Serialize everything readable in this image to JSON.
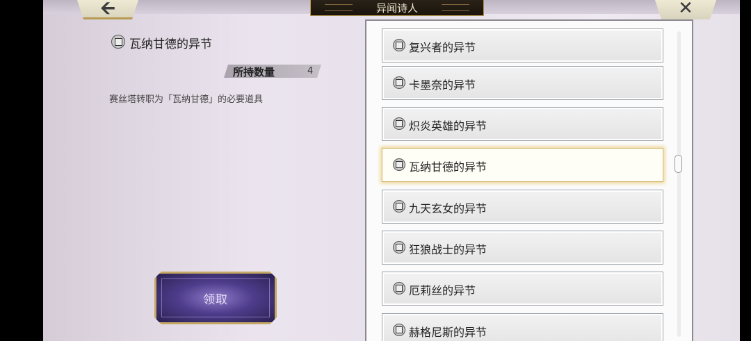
{
  "header": {
    "title": "异闻诗人",
    "back_icon": "back-arrow-icon",
    "close_icon": "close-icon"
  },
  "detail": {
    "title": "瓦纳甘德的异节",
    "quantity_label": "所持数量",
    "quantity_value": "4",
    "description": "赛丝塔转职为「瓦纳甘德」的必要道具"
  },
  "claim_button": {
    "label": "领取"
  },
  "list": {
    "items": [
      {
        "label": "复兴者的异节"
      },
      {
        "label": "卡墨奈的异节"
      },
      {
        "label": "炽炎英雄的异节"
      },
      {
        "label": "瓦纳甘德的异节",
        "selected": true
      },
      {
        "label": "九天玄女的异节"
      },
      {
        "label": "狂狼战士的异节"
      },
      {
        "label": "厄莉丝的异节"
      },
      {
        "label": "赫格尼斯的异节"
      }
    ]
  },
  "colors": {
    "selected_border": "#d3b868",
    "title_bar_bg": "#1a140c",
    "claim_button_bg": "#4e3d8c",
    "accent_gold": "#c5a865"
  }
}
